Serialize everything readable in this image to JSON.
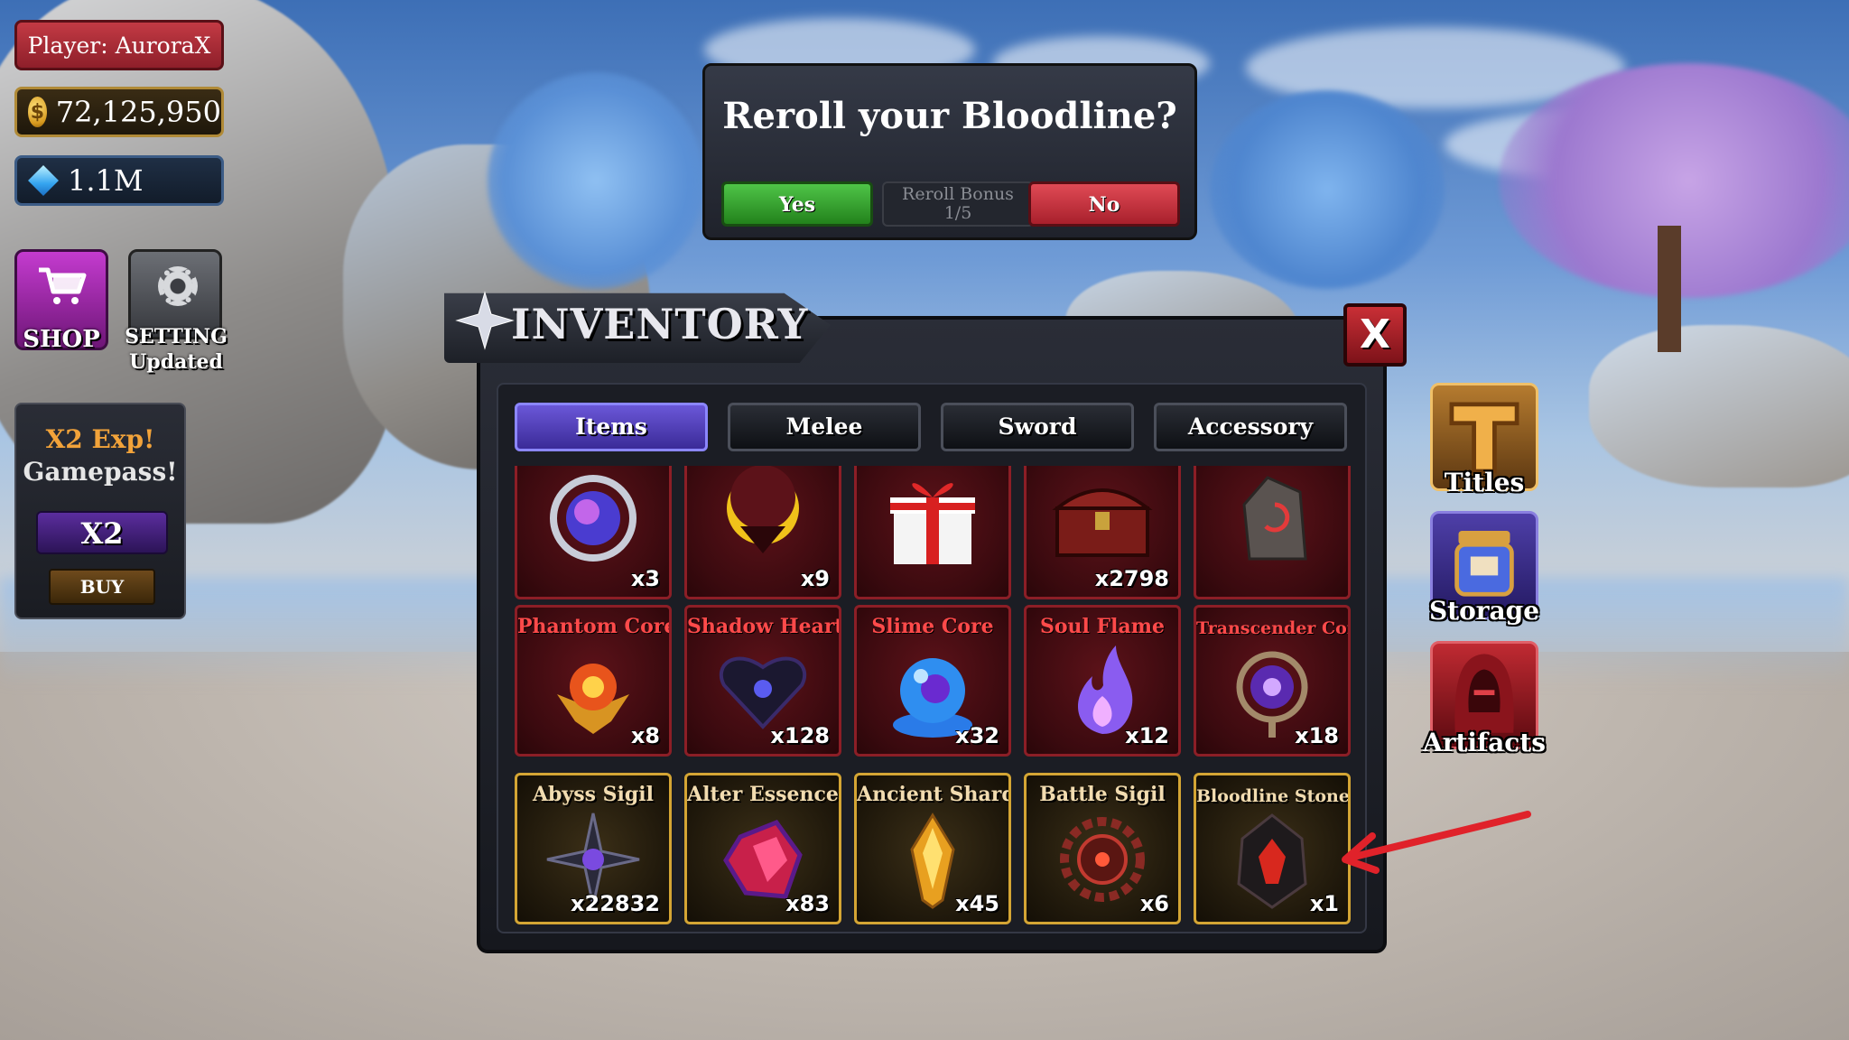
{
  "hud": {
    "player": "Player: AuroraX",
    "gold": "72,125,950",
    "gems": "1.1M",
    "shop_label": "SHOP",
    "setting_label": "SETTING",
    "setting_sub": "Updated"
  },
  "gamepass": {
    "title1": "X2 Exp!",
    "title2": "Gamepass!",
    "badge": "X2",
    "buy_label": "BUY"
  },
  "dialog": {
    "title": "Reroll your Bloodline?",
    "yes_label": "Yes",
    "reroll_line1": "Reroll Bonus",
    "reroll_line2": "1/5",
    "no_label": "No"
  },
  "inventory": {
    "title": "INVENTORY",
    "close_label": "X",
    "tabs": [
      "Items",
      "Melee",
      "Sword",
      "Accessory"
    ],
    "active_tab": "Items",
    "row1": [
      {
        "name": "",
        "count": "x3",
        "icon": "blue-orb-icon"
      },
      {
        "name": "",
        "count": "x9",
        "icon": "crescent-moon-icon"
      },
      {
        "name": "",
        "count": "",
        "icon": "gift-box-icon"
      },
      {
        "name": "",
        "count": "x2798",
        "icon": "treasure-chest-icon"
      },
      {
        "name": "",
        "count": "",
        "icon": "rune-stone-icon"
      }
    ],
    "row2": [
      {
        "name": "Phantom Core",
        "count": "x8",
        "icon": "phantom-core-icon"
      },
      {
        "name": "Shadow Heart",
        "count": "x128",
        "icon": "shadow-heart-icon"
      },
      {
        "name": "Slime Core",
        "count": "x32",
        "icon": "slime-core-icon"
      },
      {
        "name": "Soul Flame",
        "count": "x12",
        "icon": "soul-flame-icon"
      },
      {
        "name": "Transcender Core",
        "count": "x18",
        "icon": "transcender-core-icon"
      }
    ],
    "row3": [
      {
        "name": "Abyss Sigil",
        "count": "x22832",
        "icon": "abyss-sigil-icon"
      },
      {
        "name": "Alter Essence",
        "count": "x83",
        "icon": "alter-essence-icon"
      },
      {
        "name": "Ancient Shard",
        "count": "x45",
        "icon": "ancient-shard-icon"
      },
      {
        "name": "Battle Sigil",
        "count": "x6",
        "icon": "battle-sigil-icon"
      },
      {
        "name": "Bloodline Stone",
        "count": "x1",
        "icon": "bloodline-stone-icon"
      }
    ]
  },
  "side_menu": {
    "titles": "Titles",
    "storage": "Storage",
    "artifacts": "Artifacts"
  },
  "colors": {
    "yes": "#3aa832",
    "no": "#c22f3a",
    "tab_active": "#4f3fc0",
    "red_cell_border": "#8c1e26",
    "gold_cell_border": "#d4a534",
    "annotation_arrow": "#e0222a"
  }
}
